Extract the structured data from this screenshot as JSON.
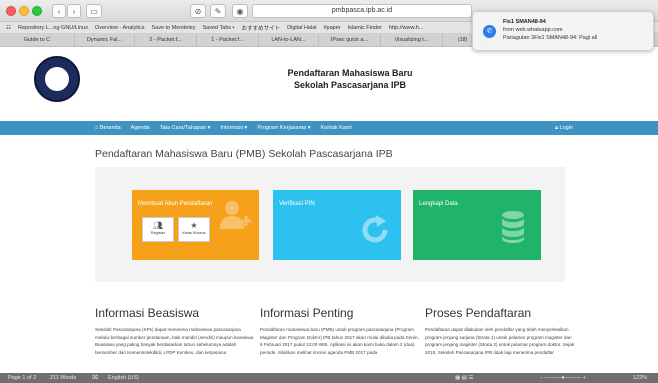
{
  "browser": {
    "url": "pmbpasca.ipb.ac.id",
    "bookmarks": [
      "Repository L...ng GNU/Linux",
      "Overview - Analytics",
      "Save to Mendeley",
      "Saved Tabs ▪",
      "おすすめサイト",
      "Digital Halal",
      "#paper",
      "Islamic Finder",
      "http://www.h..."
    ],
    "tabs": [
      "Guide to C",
      "Dynamic Fal...",
      "2 - Packet.f...",
      "1 - Packet.f...",
      "LAN-to-LAN...",
      "IPsec quick a...",
      "Visualizing t...",
      "(18)"
    ]
  },
  "notification": {
    "title": "Fis1 SMAN48-94",
    "source": "from web.whatsapp.com",
    "message": "Pariagutan 3Fis1 SMAN48-94: Pagi all"
  },
  "site": {
    "title_line1": "Pendaftaran Mahasiswa Baru",
    "title_line2": "Sekolah Pascasarjana IPB",
    "nav": [
      "Beranda",
      "Agenda",
      "Tata Cara/Tahapan ▾",
      "Informasi ▾",
      "Program Kerjasama ▾",
      "Kontak Kami"
    ],
    "login": "Login"
  },
  "main": {
    "heading": "Pendaftaran Mahasiswa Baru (PMB) Sekolah Pascasarjana IPB",
    "tiles": {
      "akun": "Membuat Akun Pendaftaran",
      "register": "Register",
      "kelas_khusus": "Kelas Khusus",
      "verifikasi": "Verifikasi PIN",
      "lengkapi": "Lengkapi Data"
    },
    "columns": [
      {
        "title": "Informasi Beasiswa",
        "body": "Sekolah Pascasarjana (SPs) dapat menerima mahasiswa pascasarjana melalui berbagai sumber pendanaan, baik mandiri (sendiri) maupun beasiswa. Beasiswa yang paling banyak berdasarkan tahun sebelumnya adalah bersumber dari Kemenristekdikti, LPDP Kemkeu, dan kerjasama"
      },
      {
        "title": "Informasi Penting",
        "body": "Pendaftaran mahasiswa baru (PMB) untuk program pascasarjana (Program Magister dan Program Doktor) IPB tahun 2017 akan mulai dibuka pada Senin, 6 Februari 2017 pukul 13:00 WIB. Aplikasi ini akan kami buka dalam 2 (dua) periode. Silahkan melihat rincian agenda PMB 2017 pada"
      },
      {
        "title": "Proses Pendaftaran",
        "body": "Pendaftaran dapat dilakukan oleh pendaftar yang telah menyelesaikan program jenjang sarjana (Strata 1) untuk pelamar program magister dan program jenjang magister (Strata 2) untuk pelamar program doktor. Sejak 2015, Sekolah Pascasarjana IPB tidak lagi menerima pendaftar"
      }
    ]
  },
  "statusbar": {
    "page": "Page 1 of 2",
    "words": "211 Words",
    "language": "English (US)",
    "zoom": "122%"
  },
  "colors": {
    "nav": "#3f93c2",
    "tile_orange": "#f5a11a",
    "tile_cyan": "#2dc1ef",
    "tile_green": "#20b46a"
  }
}
